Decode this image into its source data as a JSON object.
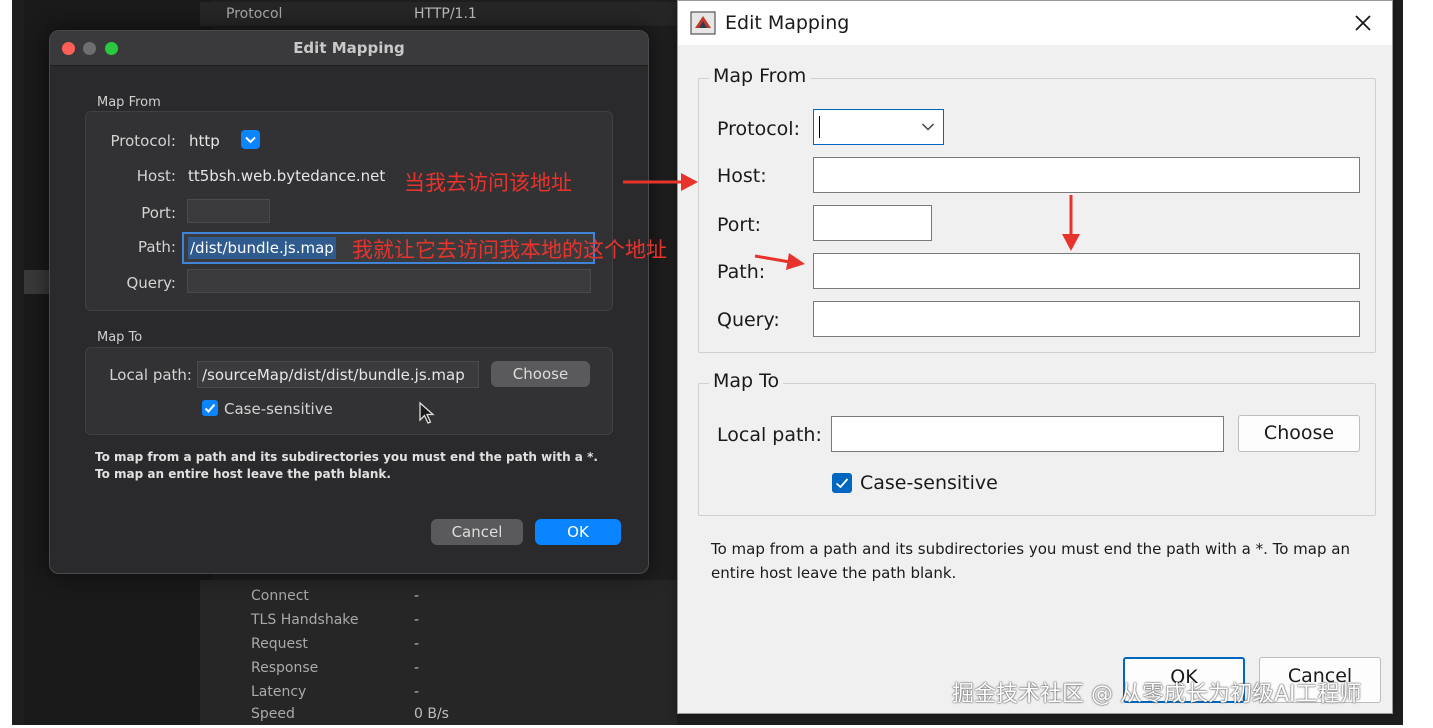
{
  "background_app": {
    "protocol_label": "Protocol",
    "protocol_value": "HTTP/1.1",
    "timing_rows": [
      {
        "label": "Connect",
        "value": "-"
      },
      {
        "label": "TLS Handshake",
        "value": "-"
      },
      {
        "label": "Request",
        "value": "-"
      },
      {
        "label": "Response",
        "value": "-"
      },
      {
        "label": "Latency",
        "value": "-"
      },
      {
        "label": "Speed",
        "value": "0 B/s"
      }
    ]
  },
  "mac_dialog": {
    "title": "Edit Mapping",
    "map_from_label": "Map From",
    "protocol_label": "Protocol:",
    "protocol_value": "http",
    "host_label": "Host:",
    "host_value": "tt5bsh.web.bytedance.net",
    "port_label": "Port:",
    "port_value": "",
    "path_label": "Path:",
    "path_value": "/dist/bundle.js.map",
    "query_label": "Query:",
    "query_value": "",
    "map_to_label": "Map To",
    "local_path_label": "Local path:",
    "local_path_value": "/sourceMap/dist/dist/bundle.js.map",
    "choose_label": "Choose",
    "case_sensitive_label": "Case-sensitive",
    "case_sensitive_checked": true,
    "help_text": "To map from a path and its subdirectories you must end the path with a *. To map an entire host leave the path blank.",
    "cancel_label": "Cancel",
    "ok_label": "OK"
  },
  "annotations": {
    "host_note": "当我去访问该地址",
    "path_note": "我就让它去访问我本地的这个地址"
  },
  "win_dialog": {
    "title": "Edit Mapping",
    "close_icon": "close-icon",
    "map_from_label": "Map From",
    "protocol_label": "Protocol:",
    "protocol_value": "",
    "host_label": "Host:",
    "host_value": "",
    "port_label": "Port:",
    "port_value": "",
    "path_label": "Path:",
    "path_value": "",
    "query_label": "Query:",
    "query_value": "",
    "map_to_label": "Map To",
    "local_path_label": "Local path:",
    "local_path_value": "",
    "choose_label": "Choose",
    "case_sensitive_label": "Case-sensitive",
    "case_sensitive_checked": true,
    "help_text": "To map from a path and its subdirectories you must end the path with a *. To map an entire host leave the path blank.",
    "ok_label": "OK",
    "cancel_label": "Cancel"
  },
  "watermark": "掘金技术社区 @ 从零成长为初级AI工程师",
  "colors": {
    "annotation": "#e8332d",
    "mac_accent": "#0a84ff",
    "win_accent": "#0067c0"
  }
}
